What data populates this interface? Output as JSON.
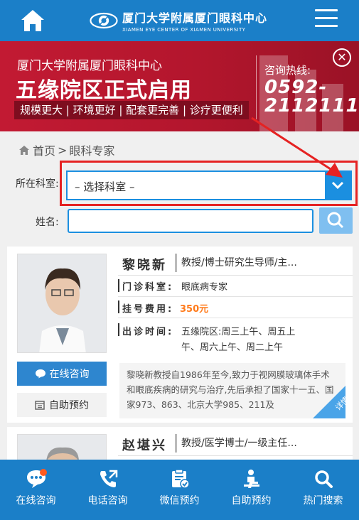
{
  "header": {
    "logo_cn": "厦门大学附属厦门眼科中心",
    "logo_en": "XIAMEN EYE CENTER OF XIAMEN UNIVERSITY",
    "icons": [
      "home-icon",
      "logo-eye-icon",
      "menu-icon"
    ]
  },
  "banner": {
    "subtitle": "厦门大学附属厦门眼科中心",
    "title": "五缘院区正式启用",
    "tags": "规模更大 | 环境更好 | 配套更完善 | 诊疗更便利",
    "hotline_label": "咨询热线:",
    "hotline_number": "0592-2112111",
    "close_label": "✕"
  },
  "breadcrumb": {
    "home": "首页",
    "separator": ">",
    "current": "眼科专家"
  },
  "form": {
    "dept_label": "所在科室:",
    "dept_value": "– 选择科室 –",
    "name_label": "姓名:",
    "name_value": ""
  },
  "doctors": [
    {
      "name": "黎晓新",
      "title": "教授/博士研究生导师/主...",
      "dept_label": "门诊科室:",
      "dept": "眼底病专家",
      "fee_label": "挂号费用:",
      "fee": "350元",
      "time_label": "出诊时间:",
      "time_line1": "五缘院区:周三上午、周五上",
      "time_line2": "午、周六上午、周二上午",
      "consult_label": "在线咨询",
      "book_label": "自助预约",
      "intro": "黎晓新教授自1986年至今,致力于视网膜玻璃体手术和眼底疾病的研究与治疗,先后承担了国家十一五、国家973、863、北京大学985、211及",
      "badge": "详情"
    },
    {
      "name": "赵堪兴",
      "title": "教授/医学博士/一级主任..."
    }
  ],
  "nav": [
    {
      "label": "在线咨询",
      "icon": "chat-icon"
    },
    {
      "label": "电话咨询",
      "icon": "phone-icon"
    },
    {
      "label": "微信预约",
      "icon": "clipboard-check-icon"
    },
    {
      "label": "自助预约",
      "icon": "person-desk-icon"
    },
    {
      "label": "热门搜索",
      "icon": "search-icon"
    }
  ],
  "colors": {
    "brand": "#1b7fc8",
    "banner": "#c21a33",
    "accent_fee": "#ff7a1a",
    "annotation": "#e52222"
  }
}
